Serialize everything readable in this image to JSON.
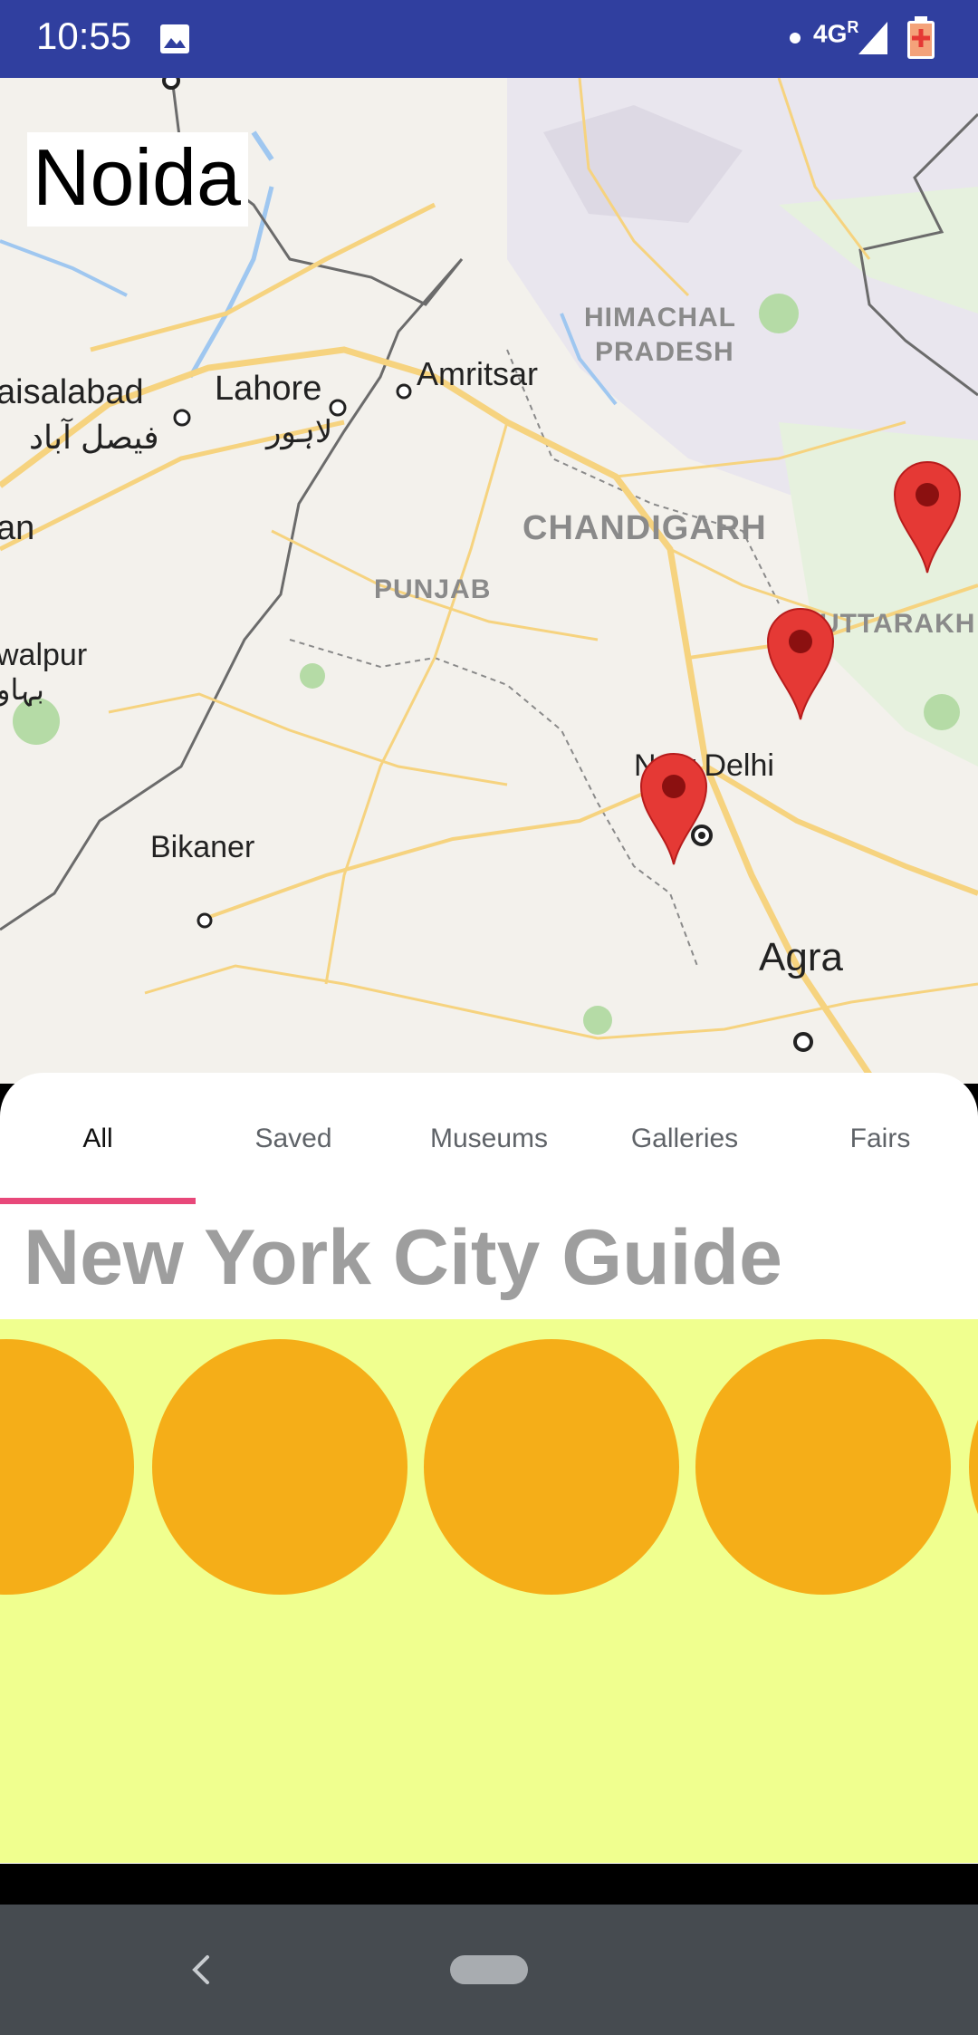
{
  "status_bar": {
    "time": "10:55",
    "network": "4G",
    "network_superscript": "R",
    "icons": [
      "image-icon",
      "signal-icon",
      "battery-icon"
    ]
  },
  "map": {
    "city_title": "Noida",
    "labels": {
      "faisalabad": "aisalabad",
      "faisalabad_urdu": "فیصل آباد",
      "lahore": "Lahore",
      "lahore_urdu": "لاہور",
      "amritsar": "Amritsar",
      "himachal_1": "HIMACHAL",
      "himachal_2": "PRADESH",
      "chandigarh": "CHANDIGARH",
      "punjab": "PUNJAB",
      "uttarakhand": "UTTARAKH",
      "bahawalpur": "walpur",
      "bahawalpur_urdu": "بہاو",
      "an": "an",
      "bikaner": "Bikaner",
      "new_delhi": "New Delhi",
      "agra": "Agra"
    },
    "marker_icon": "map-pin-icon"
  },
  "tabs": [
    {
      "label": "All",
      "active": true
    },
    {
      "label": "Saved",
      "active": false
    },
    {
      "label": "Museums",
      "active": false
    },
    {
      "label": "Galleries",
      "active": false
    },
    {
      "label": "Fairs",
      "active": false
    }
  ],
  "guide": {
    "title": "New York City Guide"
  },
  "navigation": {
    "icons": [
      "back-icon",
      "home-pill-icon"
    ]
  },
  "colors": {
    "status_bar": "#303F9F",
    "tab_indicator": "#E8487A",
    "panel_bg": "#F0FF8F",
    "circle": "#F5AE18",
    "marker": "#E53935",
    "nav_bar": "#464B50"
  }
}
